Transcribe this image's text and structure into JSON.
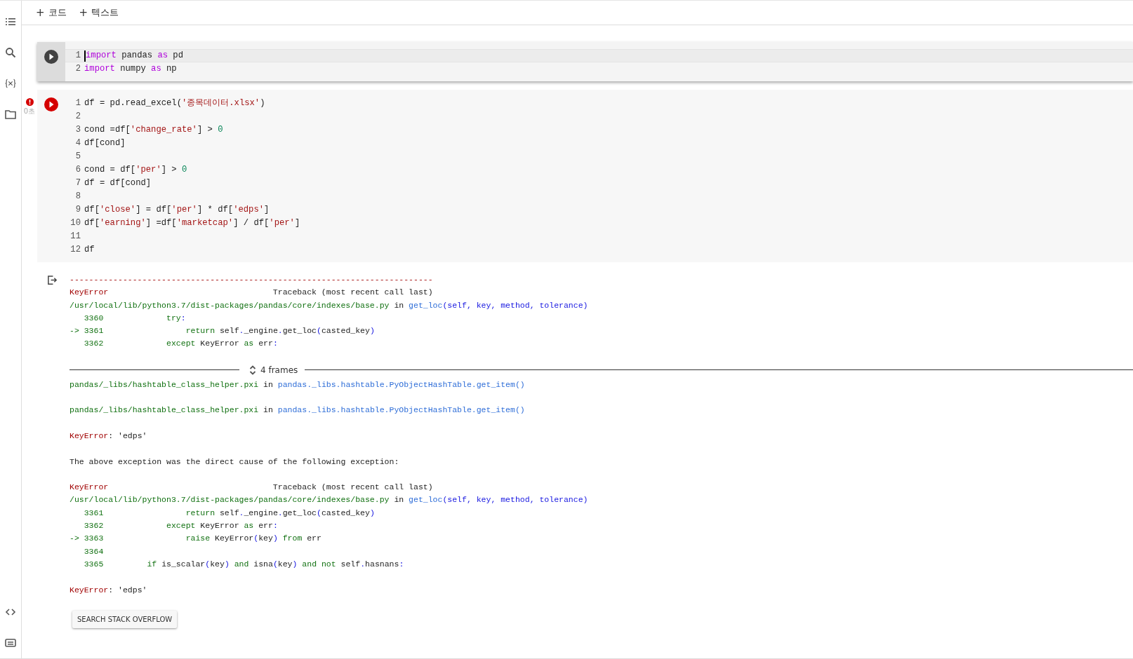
{
  "toolbar": {
    "buttons": [
      {
        "icon": "+",
        "label": "코드"
      },
      {
        "icon": "+",
        "label": "텍스트"
      }
    ]
  },
  "cells": [
    {
      "focused": true,
      "error": false,
      "lines": [
        {
          "num": "1",
          "tokens": [
            {
              "kind": "kw",
              "text": "import"
            },
            {
              "kind": "plain",
              "text": " pandas "
            },
            {
              "kind": "kw",
              "text": "as"
            },
            {
              "kind": "plain",
              "text": " pd"
            }
          ]
        },
        {
          "num": "2",
          "tokens": [
            {
              "kind": "kw",
              "text": "import"
            },
            {
              "kind": "plain",
              "text": " numpy "
            },
            {
              "kind": "kw",
              "text": "as"
            },
            {
              "kind": "plain",
              "text": " np"
            }
          ]
        }
      ]
    },
    {
      "focused": false,
      "error": true,
      "status_time": "0초",
      "lines": [
        {
          "num": "1",
          "tokens": [
            {
              "kind": "plain",
              "text": "df = pd.read_excel("
            },
            {
              "kind": "str",
              "text": "'종목데이터.xlsx'"
            },
            {
              "kind": "plain",
              "text": ")"
            }
          ]
        },
        {
          "num": "2"
        },
        {
          "num": "3",
          "tokens": [
            {
              "kind": "plain",
              "text": "cond =df["
            },
            {
              "kind": "str",
              "text": "'change_rate'"
            },
            {
              "kind": "plain",
              "text": "] > "
            },
            {
              "kind": "num",
              "text": "0"
            }
          ]
        },
        {
          "num": "4",
          "tokens": [
            {
              "kind": "plain",
              "text": "df[cond]"
            }
          ]
        },
        {
          "num": "5"
        },
        {
          "num": "6",
          "tokens": [
            {
              "kind": "plain",
              "text": "cond = df["
            },
            {
              "kind": "str",
              "text": "'per'"
            },
            {
              "kind": "plain",
              "text": "] > "
            },
            {
              "kind": "num",
              "text": "0"
            }
          ]
        },
        {
          "num": "7",
          "tokens": [
            {
              "kind": "plain",
              "text": "df = df[cond]"
            }
          ]
        },
        {
          "num": "8"
        },
        {
          "num": "9",
          "tokens": [
            {
              "kind": "plain",
              "text": "df["
            },
            {
              "kind": "str",
              "text": "'close'"
            },
            {
              "kind": "plain",
              "text": "] = df["
            },
            {
              "kind": "str",
              "text": "'per'"
            },
            {
              "kind": "plain",
              "text": "] * df["
            },
            {
              "kind": "str",
              "text": "'edps'"
            },
            {
              "kind": "plain",
              "text": "]"
            }
          ]
        },
        {
          "num": "10",
          "tokens": [
            {
              "kind": "plain",
              "text": "df["
            },
            {
              "kind": "str",
              "text": "'earning'"
            },
            {
              "kind": "plain",
              "text": "] =df["
            },
            {
              "kind": "str",
              "text": "'marketcap'"
            },
            {
              "kind": "plain",
              "text": "] / df["
            },
            {
              "kind": "str",
              "text": "'per'"
            },
            {
              "kind": "plain",
              "text": "]"
            }
          ]
        },
        {
          "num": "11"
        },
        {
          "num": "12",
          "tokens": [
            {
              "kind": "plain",
              "text": "df"
            }
          ]
        }
      ]
    }
  ],
  "output": {
    "lines": [
      {
        "kind": "text",
        "segments": [
          {
            "kind": "err",
            "text": "---------------------------------------------------------------------------"
          }
        ]
      },
      {
        "kind": "text",
        "segments": [
          {
            "kind": "err",
            "text": "KeyError"
          },
          {
            "kind": "plain",
            "text": "                                  Traceback (most recent call last)"
          }
        ]
      },
      {
        "kind": "text",
        "segments": [
          {
            "kind": "path",
            "text": "/usr/local/lib/python3.7/dist-packages/pandas/core/indexes/base.py"
          },
          {
            "kind": "plain",
            "text": " in "
          },
          {
            "kind": "link",
            "text": "get_loc"
          },
          {
            "kind": "paren",
            "text": "(self, key, method, tolerance)"
          }
        ]
      },
      {
        "kind": "text",
        "segments": [
          {
            "kind": "path",
            "text": "   3360             try"
          },
          {
            "kind": "paren",
            "text": ":"
          }
        ]
      },
      {
        "kind": "text",
        "segments": [
          {
            "kind": "path",
            "text": "-> 3361                 return"
          },
          {
            "kind": "plain",
            "text": " self"
          },
          {
            "kind": "paren",
            "text": "."
          },
          {
            "kind": "plain",
            "text": "_engine"
          },
          {
            "kind": "paren",
            "text": "."
          },
          {
            "kind": "plain",
            "text": "get_loc"
          },
          {
            "kind": "paren",
            "text": "("
          },
          {
            "kind": "plain",
            "text": "casted_key"
          },
          {
            "kind": "paren",
            "text": ")"
          }
        ]
      },
      {
        "kind": "text",
        "segments": [
          {
            "kind": "path",
            "text": "   3362             except"
          },
          {
            "kind": "plain",
            "text": " KeyError "
          },
          {
            "kind": "path",
            "text": "as"
          },
          {
            "kind": "plain",
            "text": " err"
          },
          {
            "kind": "paren",
            "text": ":"
          }
        ]
      },
      {
        "kind": "frames",
        "label": "4 frames"
      },
      {
        "kind": "text",
        "segments": [
          {
            "kind": "path",
            "text": "pandas/_libs/hashtable_class_helper.pxi"
          },
          {
            "kind": "plain",
            "text": " in "
          },
          {
            "kind": "link",
            "text": "pandas._libs.hashtable.PyObjectHashTable.get_item()"
          }
        ]
      },
      {
        "kind": "blank"
      },
      {
        "kind": "text",
        "segments": [
          {
            "kind": "path",
            "text": "pandas/_libs/hashtable_class_helper.pxi"
          },
          {
            "kind": "plain",
            "text": " in "
          },
          {
            "kind": "link",
            "text": "pandas._libs.hashtable.PyObjectHashTable.get_item()"
          }
        ]
      },
      {
        "kind": "blank"
      },
      {
        "kind": "text",
        "segments": [
          {
            "kind": "err",
            "text": "KeyError"
          },
          {
            "kind": "plain",
            "text": ": 'edps'"
          }
        ]
      },
      {
        "kind": "blank"
      },
      {
        "kind": "text",
        "segments": [
          {
            "kind": "plain",
            "text": "The above exception was the direct cause of the following exception:"
          }
        ]
      },
      {
        "kind": "blank"
      },
      {
        "kind": "text",
        "segments": [
          {
            "kind": "err",
            "text": "KeyError"
          },
          {
            "kind": "plain",
            "text": "                                  Traceback (most recent call last)"
          }
        ]
      },
      {
        "kind": "text",
        "segments": [
          {
            "kind": "path",
            "text": "/usr/local/lib/python3.7/dist-packages/pandas/core/indexes/base.py"
          },
          {
            "kind": "plain",
            "text": " in "
          },
          {
            "kind": "link",
            "text": "get_loc"
          },
          {
            "kind": "paren",
            "text": "(self, key, method, tolerance)"
          }
        ]
      },
      {
        "kind": "text",
        "segments": [
          {
            "kind": "path",
            "text": "   3361                 return"
          },
          {
            "kind": "plain",
            "text": " self"
          },
          {
            "kind": "paren",
            "text": "."
          },
          {
            "kind": "plain",
            "text": "_engine"
          },
          {
            "kind": "paren",
            "text": "."
          },
          {
            "kind": "plain",
            "text": "get_loc"
          },
          {
            "kind": "paren",
            "text": "("
          },
          {
            "kind": "plain",
            "text": "casted_key"
          },
          {
            "kind": "paren",
            "text": ")"
          }
        ]
      },
      {
        "kind": "text",
        "segments": [
          {
            "kind": "path",
            "text": "   3362             except"
          },
          {
            "kind": "plain",
            "text": " KeyError "
          },
          {
            "kind": "path",
            "text": "as"
          },
          {
            "kind": "plain",
            "text": " err"
          },
          {
            "kind": "paren",
            "text": ":"
          }
        ]
      },
      {
        "kind": "text",
        "segments": [
          {
            "kind": "path",
            "text": "-> 3363                 raise"
          },
          {
            "kind": "plain",
            "text": " KeyError"
          },
          {
            "kind": "paren",
            "text": "("
          },
          {
            "kind": "plain",
            "text": "key"
          },
          {
            "kind": "paren",
            "text": ")"
          },
          {
            "kind": "path",
            "text": " from"
          },
          {
            "kind": "plain",
            "text": " err"
          }
        ]
      },
      {
        "kind": "text",
        "segments": [
          {
            "kind": "path",
            "text": "   3364"
          }
        ]
      },
      {
        "kind": "text",
        "segments": [
          {
            "kind": "path",
            "text": "   3365         if"
          },
          {
            "kind": "plain",
            "text": " is_scalar"
          },
          {
            "kind": "paren",
            "text": "("
          },
          {
            "kind": "plain",
            "text": "key"
          },
          {
            "kind": "paren",
            "text": ")"
          },
          {
            "kind": "path",
            "text": " and"
          },
          {
            "kind": "plain",
            "text": " isna"
          },
          {
            "kind": "paren",
            "text": "("
          },
          {
            "kind": "plain",
            "text": "key"
          },
          {
            "kind": "paren",
            "text": ")"
          },
          {
            "kind": "path",
            "text": " and not"
          },
          {
            "kind": "plain",
            "text": " self"
          },
          {
            "kind": "paren",
            "text": "."
          },
          {
            "kind": "plain",
            "text": "hasnans"
          },
          {
            "kind": "paren",
            "text": ":"
          }
        ]
      },
      {
        "kind": "blank"
      },
      {
        "kind": "text",
        "segments": [
          {
            "kind": "err",
            "text": "KeyError"
          },
          {
            "kind": "plain",
            "text": ": 'edps'"
          }
        ]
      }
    ],
    "button": "SEARCH STACK OVERFLOW"
  }
}
